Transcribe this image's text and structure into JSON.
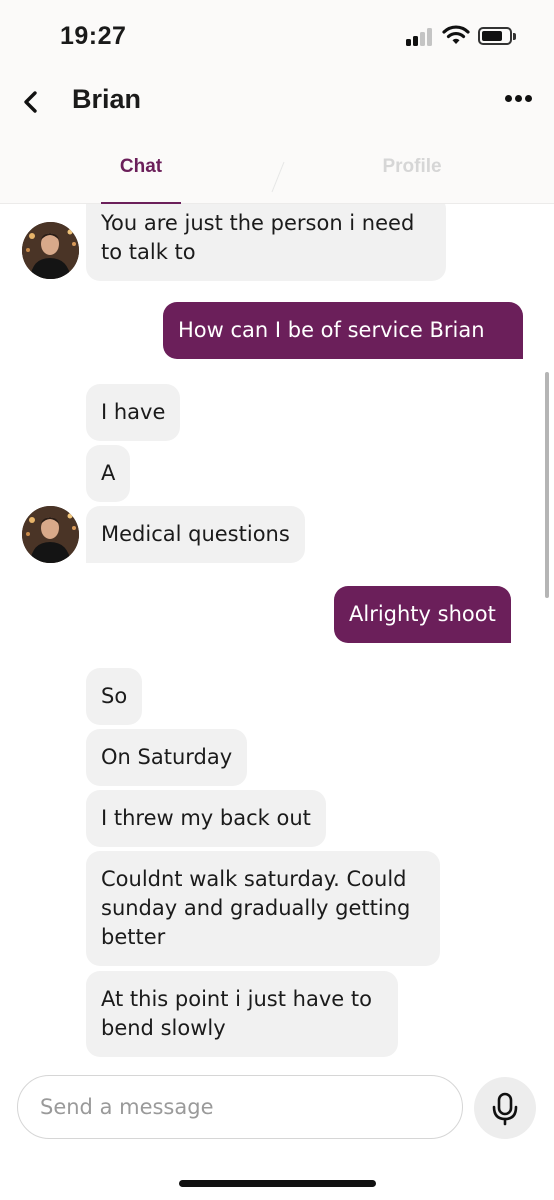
{
  "status_bar": {
    "time": "19:27",
    "battery_icon": "battery-icon",
    "wifi_icon": "wifi-icon",
    "signal_icon": "signal-icon"
  },
  "header": {
    "back_icon": "chevron-left-icon",
    "name": "Brian",
    "more_icon": "more-horizontal-icon"
  },
  "tabs": {
    "chat": "Chat",
    "profile": "Profile",
    "active": "Chat"
  },
  "colors": {
    "accent": "#6b1f5a",
    "incoming_bubble": "#f1f1f1",
    "inactive_tab": "#d6d6d6"
  },
  "messages": [
    {
      "from": "them",
      "text": "You are just the person i need to talk to"
    },
    {
      "from": "me",
      "text": "How can I be of service Brian"
    },
    {
      "from": "them",
      "text": "I have"
    },
    {
      "from": "them",
      "text": "A"
    },
    {
      "from": "them",
      "text": "Medical questions"
    },
    {
      "from": "me",
      "text": "Alrighty shoot"
    },
    {
      "from": "them",
      "text": "So"
    },
    {
      "from": "them",
      "text": "On Saturday"
    },
    {
      "from": "them",
      "text": "I threw my back out"
    },
    {
      "from": "them",
      "text": "Couldnt walk saturday. Could sunday and gradually getting better"
    },
    {
      "from": "them",
      "text": "At this point i just have to bend slowly"
    }
  ],
  "composer": {
    "placeholder": "Send a message",
    "mic_icon": "microphone-icon"
  }
}
